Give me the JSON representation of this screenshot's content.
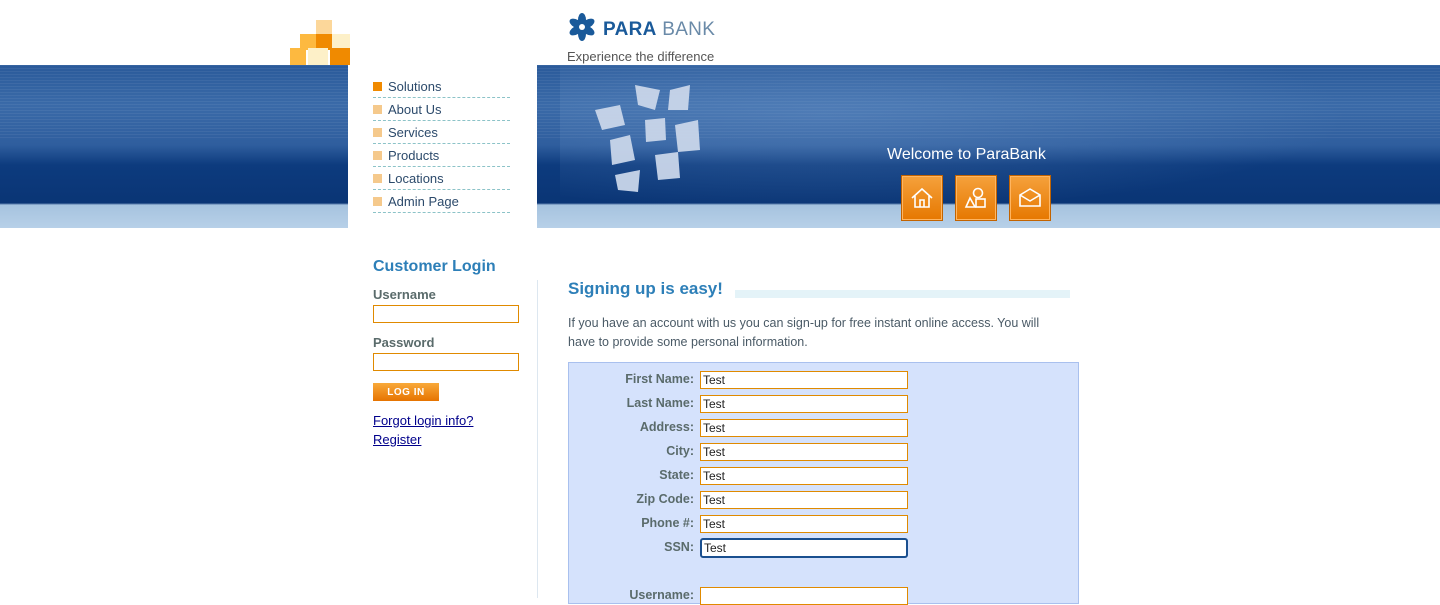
{
  "brand": {
    "name_part1": "PARA",
    "name_part2": "BANK",
    "tagline": "Experience the difference"
  },
  "nav": {
    "items": [
      {
        "label": "Solutions"
      },
      {
        "label": "About Us"
      },
      {
        "label": "Services"
      },
      {
        "label": "Products"
      },
      {
        "label": "Locations"
      },
      {
        "label": "Admin Page"
      }
    ]
  },
  "hero": {
    "welcome": "Welcome to ParaBank",
    "icons": [
      "home-icon",
      "about-icon",
      "contact-icon"
    ],
    "accent_color": "#e67800"
  },
  "login": {
    "title": "Customer Login",
    "username_label": "Username",
    "password_label": "Password",
    "username_value": "",
    "password_value": "",
    "button_label": "LOG IN",
    "forgot_link": "Forgot login info?",
    "register_link": "Register"
  },
  "register": {
    "title": "Signing up is easy!",
    "intro": "If you have an account with us you can sign-up for free instant online access. You will have to provide some personal information.",
    "fields": [
      {
        "label": "First Name:",
        "value": "Test"
      },
      {
        "label": "Last Name:",
        "value": "Test"
      },
      {
        "label": "Address:",
        "value": "Test"
      },
      {
        "label": "City:",
        "value": "Test"
      },
      {
        "label": "State:",
        "value": "Test"
      },
      {
        "label": "Zip Code:",
        "value": "Test"
      },
      {
        "label": "Phone #:",
        "value": "Test"
      },
      {
        "label": "SSN:",
        "value": "Test"
      },
      {
        "label": "Username:",
        "value": ""
      }
    ]
  }
}
